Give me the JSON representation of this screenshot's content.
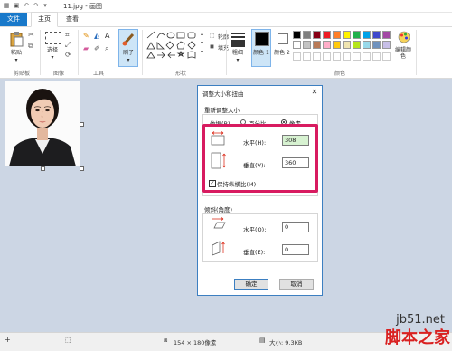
{
  "window": {
    "title": "11.jpg - 画图"
  },
  "tabs": {
    "file": "文件",
    "home": "主页",
    "view": "查看"
  },
  "ribbon": {
    "clipboard": {
      "paste": "粘贴",
      "group": "剪贴板"
    },
    "image": {
      "select": "选择",
      "group": "图像"
    },
    "tools": {
      "group": "工具"
    },
    "brushes": {
      "label": "刷子"
    },
    "shapes": {
      "outline": "轮廓",
      "fill": "填充",
      "group": "形状"
    },
    "size": {
      "label": "粗细"
    },
    "color1": {
      "label": "颜色 1"
    },
    "color2": {
      "label": "颜色 2"
    },
    "colors": {
      "group": "颜色",
      "edit": "编辑颜色"
    },
    "palette": [
      "#000000",
      "#7f7f7f",
      "#880015",
      "#ed1c24",
      "#ff7f27",
      "#fff200",
      "#22b14c",
      "#00a2e8",
      "#3f48cc",
      "#a349a4",
      "#ffffff",
      "#c3c3c3",
      "#b97a57",
      "#ffaec9",
      "#ffc90e",
      "#efe4b0",
      "#b5e61d",
      "#99d9ea",
      "#7092be",
      "#c8bfe7"
    ]
  },
  "dialog": {
    "title": "调整大小和扭曲",
    "resize_section": "重新调整大小",
    "by_label": "依据(B):",
    "percent_label": "百分比",
    "pixels_label": "像素",
    "horizontal_label": "水平(H):",
    "horizontal_value": "308",
    "vertical_label": "垂直(V):",
    "vertical_value": "360",
    "keep_ratio": "保持纵横比(M)",
    "skew_section": "倾斜(角度)",
    "skew_h_label": "水平(O):",
    "skew_h_value": "0",
    "skew_v_label": "垂直(E):",
    "skew_v_value": "0",
    "ok": "确定",
    "cancel": "取消"
  },
  "status": {
    "dimensions": "154 × 180像素",
    "size": "大小: 9.3KB"
  },
  "watermark": {
    "line1": "jb51.net",
    "line2": "脚本之家"
  }
}
